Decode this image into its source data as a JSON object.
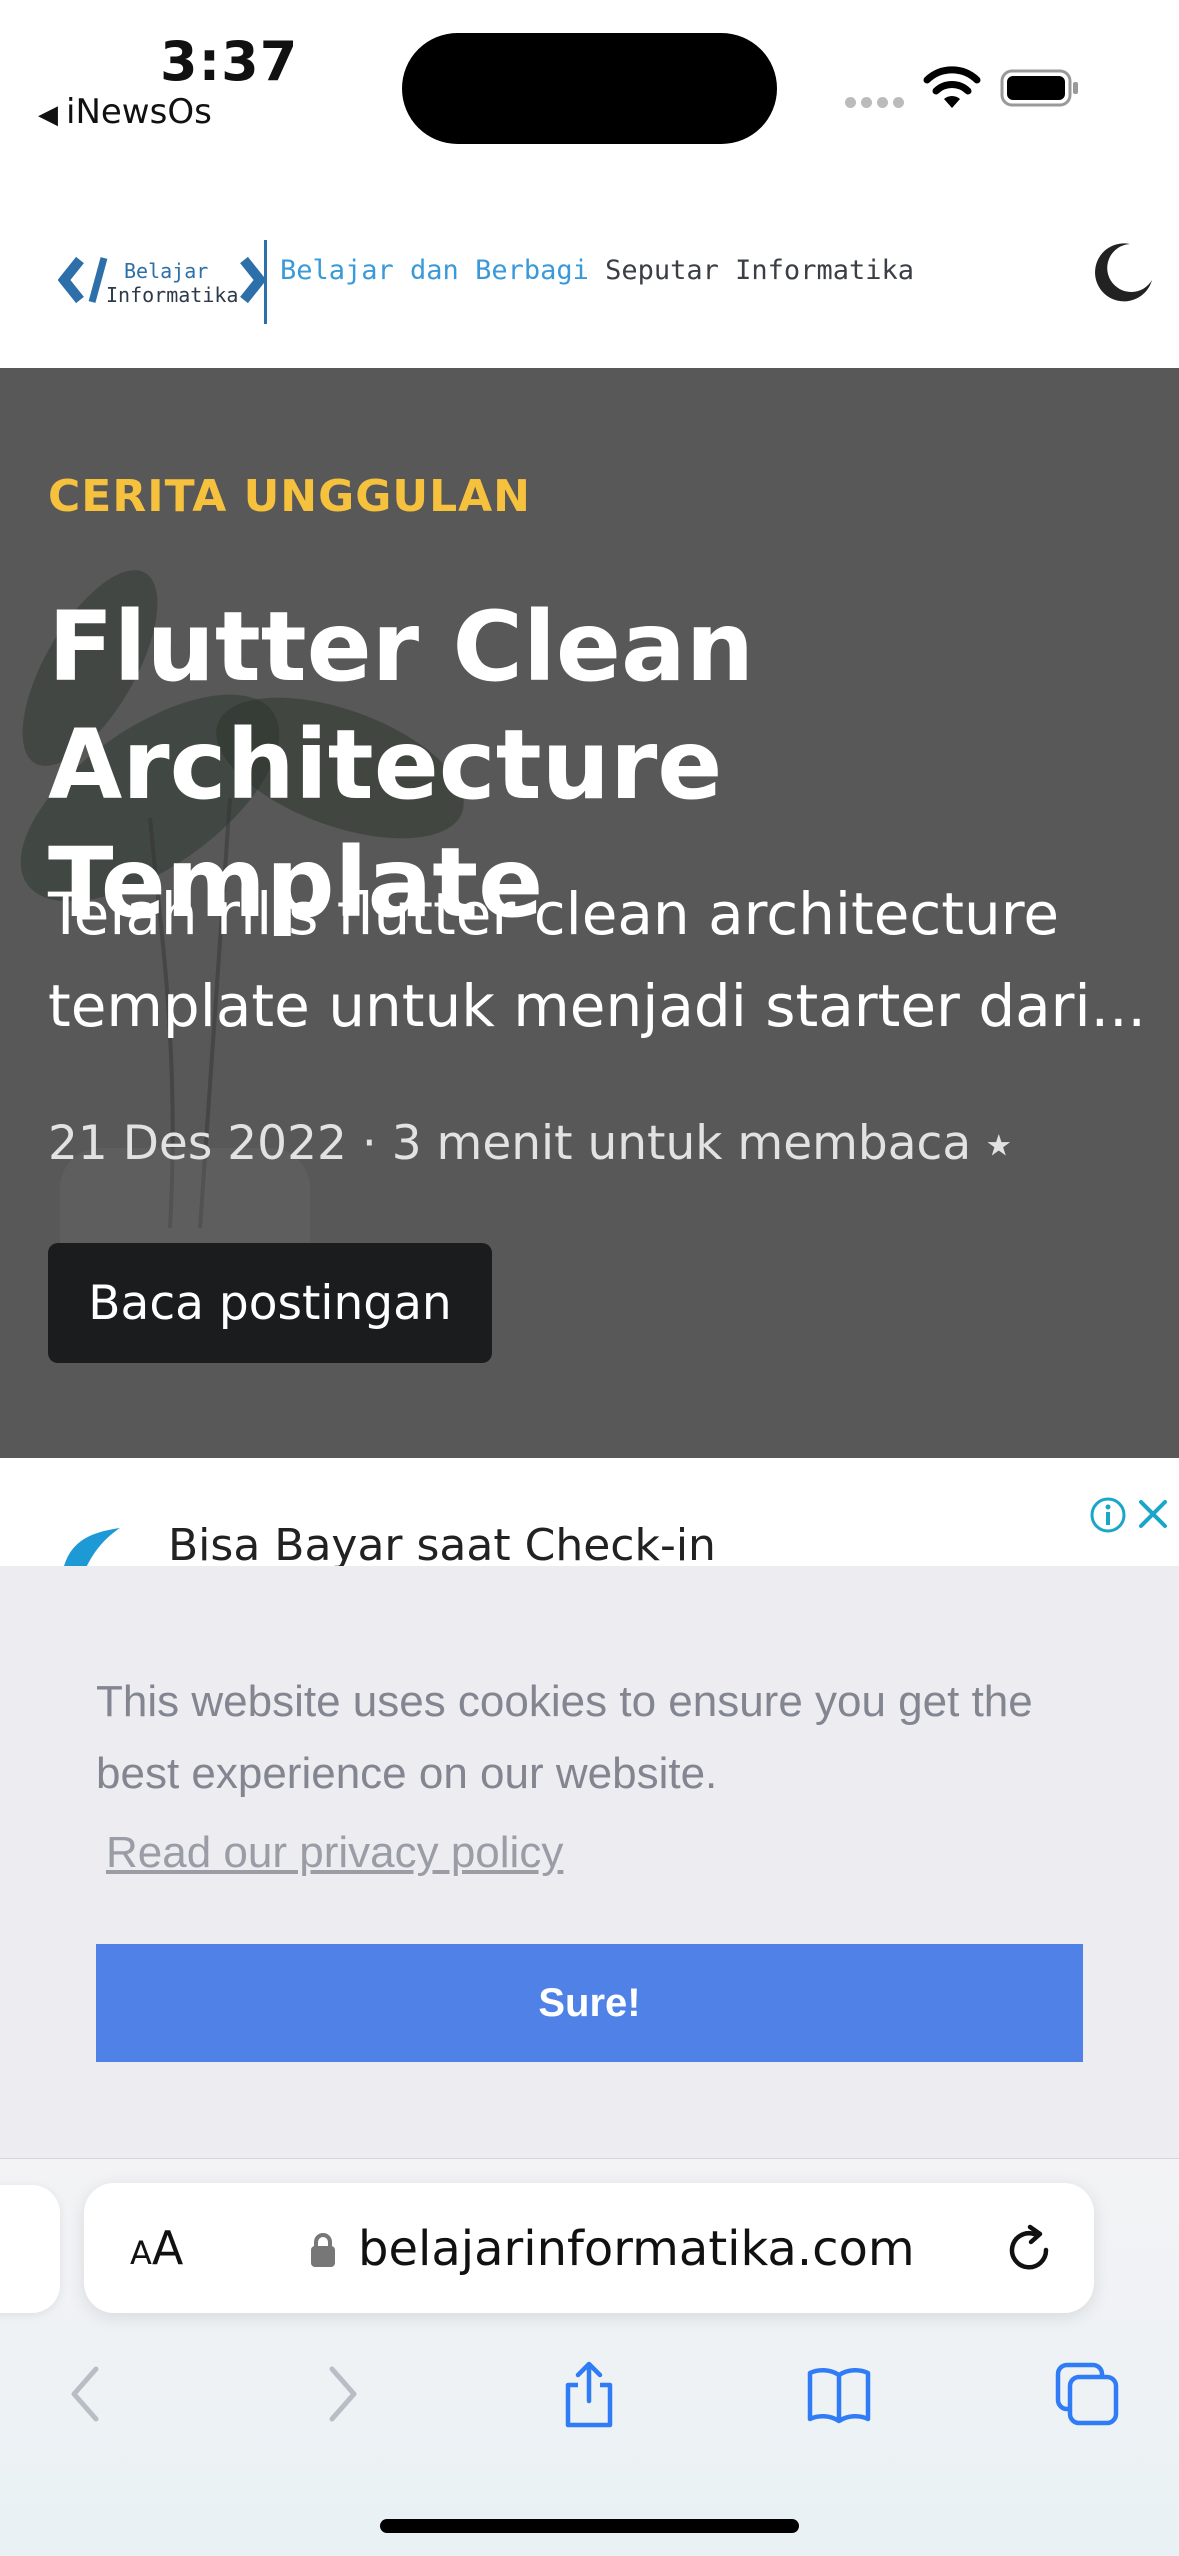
{
  "status_bar": {
    "time": "3:37",
    "back_app": "iNewsOs"
  },
  "header": {
    "logo_line1": "Belajar",
    "logo_line2": "Informatika",
    "tagline_part1": "Belajar dan Berbagi",
    "tagline_part2": "Seputar Informatika",
    "theme_icon": "moon-icon"
  },
  "hero": {
    "label": "CERITA UNGGULAN",
    "title": "Flutter Clean Architecture Template",
    "excerpt": "Telah rilis flutter clean architecture template untuk menjadi starter dari...",
    "meta": "21 Des 2022 · 3 menit untuk membaca ⭑",
    "button": "Baca postingan"
  },
  "ad": {
    "text": "Bisa Bayar saat Check-in"
  },
  "cookie": {
    "message": "This website uses cookies to ensure you get the best experience on our website.",
    "link": "Read our privacy policy",
    "button": "Sure!"
  },
  "browser": {
    "text_size_label": "AA",
    "url": "belajarinformatika.com"
  },
  "colors": {
    "accent_yellow": "#f6c23e",
    "cookie_button": "#4f81e6",
    "ios_blue": "#2f7cf6"
  }
}
